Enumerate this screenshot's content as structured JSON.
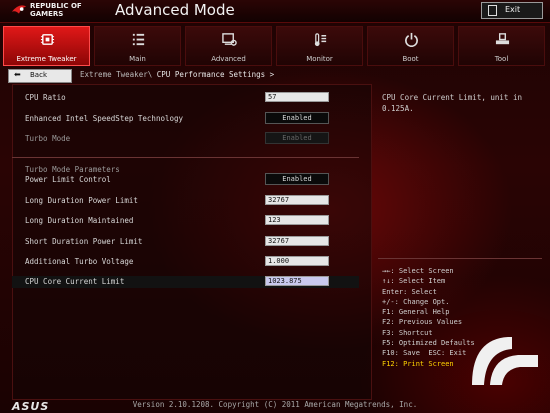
{
  "brand": {
    "rog_line1": "REPUBLIC OF",
    "rog_line2": "GAMERS",
    "asus": "ASUS"
  },
  "window_title": "Advanced Mode",
  "exit_label": "Exit",
  "tabs": [
    {
      "label": "Extreme Tweaker",
      "icon": "chip-icon",
      "active": true
    },
    {
      "label": "Main",
      "icon": "list-icon",
      "active": false
    },
    {
      "label": "Advanced",
      "icon": "advanced-icon",
      "active": false
    },
    {
      "label": "Monitor",
      "icon": "monitor-icon",
      "active": false
    },
    {
      "label": "Boot",
      "icon": "power-icon",
      "active": false
    },
    {
      "label": "Tool",
      "icon": "tool-icon",
      "active": false
    }
  ],
  "back_label": "Back",
  "breadcrumb": {
    "parent": "Extreme Tweaker\\ ",
    "current": "CPU Performance Settings >"
  },
  "settings": [
    {
      "label": "CPU Ratio",
      "value": "57",
      "kind": "input"
    },
    {
      "label": "Enhanced Intel SpeedStep Technology",
      "value": "Enabled",
      "kind": "button"
    },
    {
      "label": "Turbo Mode",
      "value": "Enabled",
      "kind": "button-disabled"
    }
  ],
  "turbo_section_title": "Turbo Mode Parameters",
  "turbo_settings": [
    {
      "label": "Power Limit Control",
      "value": "Enabled",
      "kind": "button"
    },
    {
      "label": "Long Duration Power Limit",
      "value": "32767",
      "kind": "input"
    },
    {
      "label": "Long Duration Maintained",
      "value": "123",
      "kind": "input"
    },
    {
      "label": "Short Duration Power Limit",
      "value": "32767",
      "kind": "input"
    },
    {
      "label": "Additional Turbo Voltage",
      "value": "1.000",
      "kind": "input"
    },
    {
      "label": "CPU Core Current Limit",
      "value": "1023.875",
      "kind": "input",
      "selected": true
    }
  ],
  "help_text": "CPU Core Current Limit, unit in 0.125A.",
  "key_help": [
    "→←: Select Screen",
    "↑↓: Select Item",
    "Enter: Select",
    "+/-: Change Opt.",
    "F1: General Help",
    "F2: Previous Values",
    "F3: Shortcut",
    "F5: Optimized Defaults",
    "F10: Save  ESC: Exit",
    "F12: Print Screen"
  ],
  "footer": "Version 2.10.1208. Copyright (C) 2011 American Megatrends, Inc.",
  "colors": {
    "accent": "#e01818",
    "highlight_key": "#ffd400",
    "background": "#1e0303"
  }
}
